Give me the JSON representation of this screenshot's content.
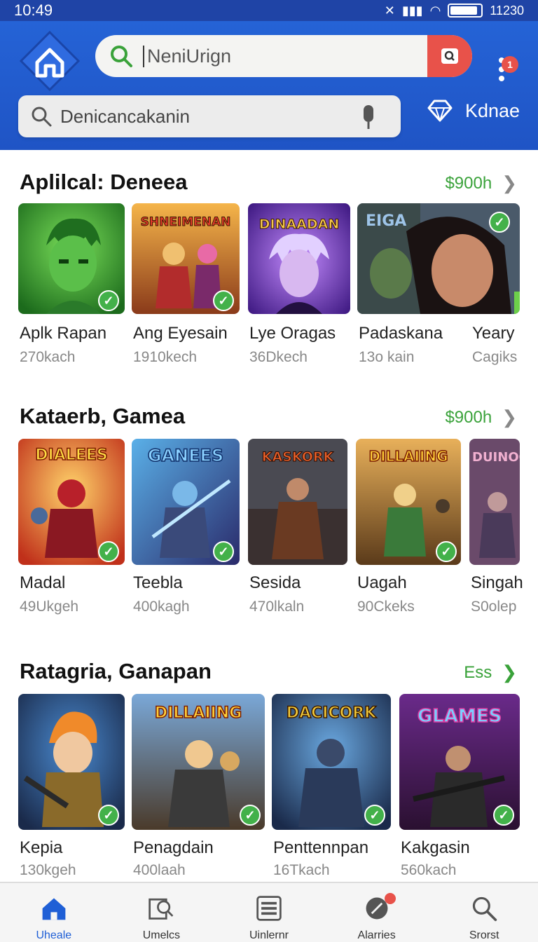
{
  "status": {
    "time": "10:49",
    "right_time": "11230"
  },
  "header": {
    "search_value": "NeniUrign",
    "search2_placeholder": "Denicancakanin",
    "notif_count": "1",
    "kdnae_label": "Kdnae"
  },
  "sections": [
    {
      "title": "Aplilcal: Deneea",
      "more": "$900h",
      "items": [
        {
          "title": "Aplk Rapan",
          "sub": "270kach"
        },
        {
          "title": "Ang Eyesain",
          "sub": "1910kech"
        },
        {
          "title": "Lye Oragas",
          "sub": "36Dkech"
        },
        {
          "title": "Padaskana",
          "sub": "13o kain"
        },
        {
          "title": "Yeary",
          "sub": "Cagiks"
        }
      ]
    },
    {
      "title": "Kataerb, Gamea",
      "more": "$900h",
      "items": [
        {
          "title": "Madal",
          "sub": "49Ukgeh"
        },
        {
          "title": "Teebla",
          "sub": "400kagh"
        },
        {
          "title": "Sesida",
          "sub": "470lkaln"
        },
        {
          "title": "Uagah",
          "sub": "90Ckeks"
        },
        {
          "title": "Singah",
          "sub": "S0olep"
        }
      ]
    },
    {
      "title": "Ratagria, Ganapan",
      "more": "Ess",
      "items": [
        {
          "title": "Kepia",
          "sub": "130kgeh"
        },
        {
          "title": "Penagdain",
          "sub": "400laah"
        },
        {
          "title": "Penttennpan",
          "sub": "16Tkach"
        },
        {
          "title": "Kakgasin",
          "sub": "560kach"
        }
      ]
    }
  ],
  "thumb_text": {
    "s0i1": "SHNEIMENAN",
    "s0i2": "DINAADAN",
    "s0i3": "EIGA",
    "s1i0": "DIALEES",
    "s1i1": "GANEES",
    "s1i2": "KASKORK",
    "s1i3": "DILLAIING",
    "s1i4": "DUINOC",
    "s2i1": "DILLAIING",
    "s2i2": "DACICORK",
    "s2i3": "GLAMES"
  },
  "nav": [
    {
      "label": "Uheale",
      "icon": "home-icon"
    },
    {
      "label": "Umelcs",
      "icon": "apps-search-icon"
    },
    {
      "label": "Uinlernr",
      "icon": "list-icon"
    },
    {
      "label": "Alarries",
      "icon": "notification-icon"
    },
    {
      "label": "Srorst",
      "icon": "search-icon"
    }
  ],
  "colors": {
    "header_blue": "#2563d6",
    "accent_green": "#3aa23a",
    "badge_red": "#e8524a",
    "nav_active": "#1f5fd6"
  }
}
